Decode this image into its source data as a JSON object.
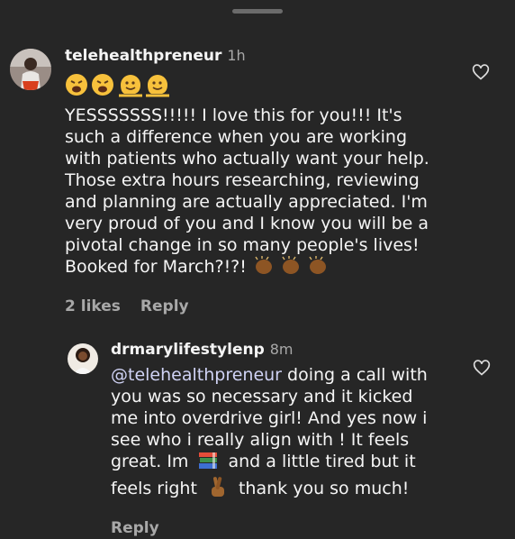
{
  "comment1": {
    "username": "telehealthpreneur",
    "time": "1h",
    "emoji_row": [
      "weary-face-emoji",
      "weary-face-emoji",
      "melting-face-emoji",
      "melting-face-emoji"
    ],
    "lines": [
      "YESSSSSSS!!!!! I love this for you!!! It's",
      "such a difference when you are working",
      "with patients who actually want your help.",
      "Those extra hours researching, reviewing",
      "and planning are actually appreciated. I'm",
      "very proud of you and I know you will be a",
      "pivotal change in so many people's lives!",
      "Booked for March?!?!"
    ],
    "trailing_emojis": [
      "clapping-hands-emoji",
      "clapping-hands-emoji",
      "clapping-hands-emoji"
    ],
    "likes": "2 likes",
    "reply": "Reply"
  },
  "reply1": {
    "username": "drmarylifestylenp",
    "time": "8m",
    "mention": "@telehealthpreneur",
    "line1_rest": " doing a call with",
    "line2": "you was so necessary and it kicked",
    "line3": "me into overdrive girl! And yes now i",
    "line4": "see who i really align with ! It feels",
    "line5_a": "great. Im",
    "line5_emoji": "books-emoji",
    "line5_b": "and a little tired but it",
    "line6_a": "feels right",
    "line6_emoji": "crossed-fingers-emoji",
    "line6_b": "thank you so much!",
    "reply": "Reply"
  }
}
